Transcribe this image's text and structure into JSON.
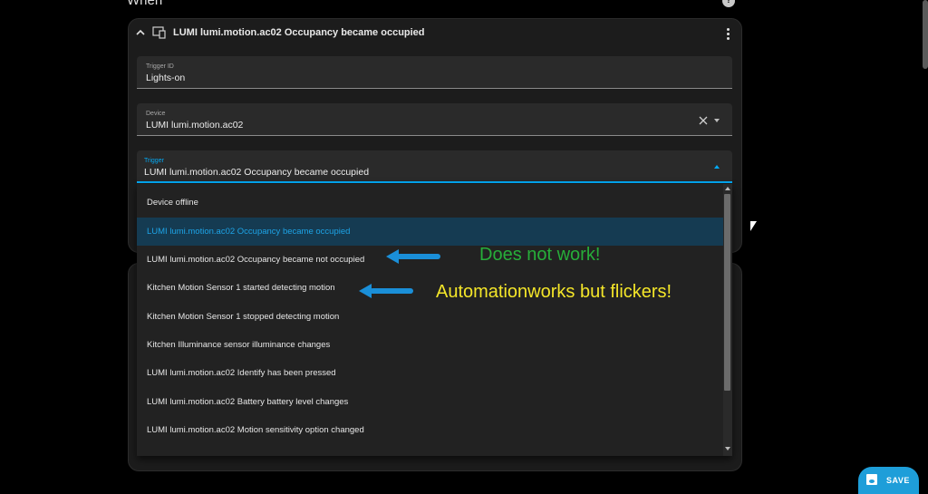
{
  "section": {
    "title": "When"
  },
  "trigger_card": {
    "title": "LUMI lumi.motion.ac02 Occupancy became occupied",
    "fields": {
      "trigger_id": {
        "label": "Trigger ID",
        "value": "Lights-on"
      },
      "device": {
        "label": "Device",
        "value": "LUMI lumi.motion.ac02"
      },
      "trigger": {
        "label": "Trigger",
        "value": "LUMI lumi.motion.ac02 Occupancy became occupied"
      }
    }
  },
  "dropdown": {
    "options": [
      {
        "label": "Device offline",
        "selected": false
      },
      {
        "label": "LUMI lumi.motion.ac02 Occupancy became occupied",
        "selected": true
      },
      {
        "label": "LUMI lumi.motion.ac02 Occupancy became not occupied",
        "selected": false
      },
      {
        "label": "Kitchen Motion Sensor 1 started detecting motion",
        "selected": false
      },
      {
        "label": "Kitchen Motion Sensor 1 stopped detecting motion",
        "selected": false
      },
      {
        "label": "Kitchen Illuminance sensor illuminance changes",
        "selected": false
      },
      {
        "label": "LUMI lumi.motion.ac02 Identify has been pressed",
        "selected": false
      },
      {
        "label": "LUMI lumi.motion.ac02 Battery battery level changes",
        "selected": false
      },
      {
        "label": "LUMI lumi.motion.ac02 Motion sensitivity option changed",
        "selected": false
      }
    ]
  },
  "annotations": {
    "note1": "Does not work!",
    "note2": "Automationworks but flickers!"
  },
  "toolbar": {
    "save_label": "SAVE"
  },
  "colors": {
    "accent": "#03a9f4",
    "note1": "#27ae3a",
    "note2": "#f4e629",
    "selected_bg": "#153b52"
  }
}
